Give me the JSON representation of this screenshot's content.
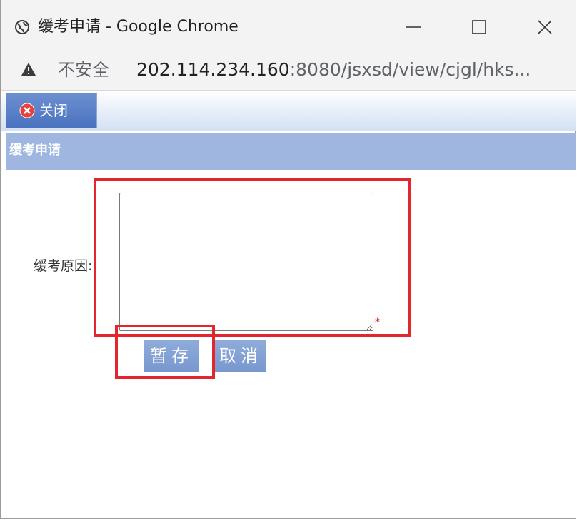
{
  "window": {
    "title": "缓考申请 - Google Chrome",
    "controls": {
      "minimize": "–",
      "maximize": "□",
      "close": "✕"
    }
  },
  "addressbar": {
    "security_label": "不安全",
    "url_host": "202.114.234.160",
    "url_rest": ":8080/jsxsd/view/cjgl/hks..."
  },
  "toolbar": {
    "close_label": "关闭"
  },
  "section": {
    "title": "缓考申请"
  },
  "form": {
    "reason_label": "缓考原因:",
    "reason_value": "",
    "required_mark": "*",
    "save_label": "暂存",
    "cancel_label": "取消"
  },
  "colors": {
    "header_bar": "#9eb6e0",
    "button": "#7f9fd3",
    "annotation": "#e3262d",
    "required": "#e02020"
  },
  "icons": {
    "title": "globe-icon",
    "address": "warning-icon",
    "toolbar": "close-circle-icon"
  }
}
